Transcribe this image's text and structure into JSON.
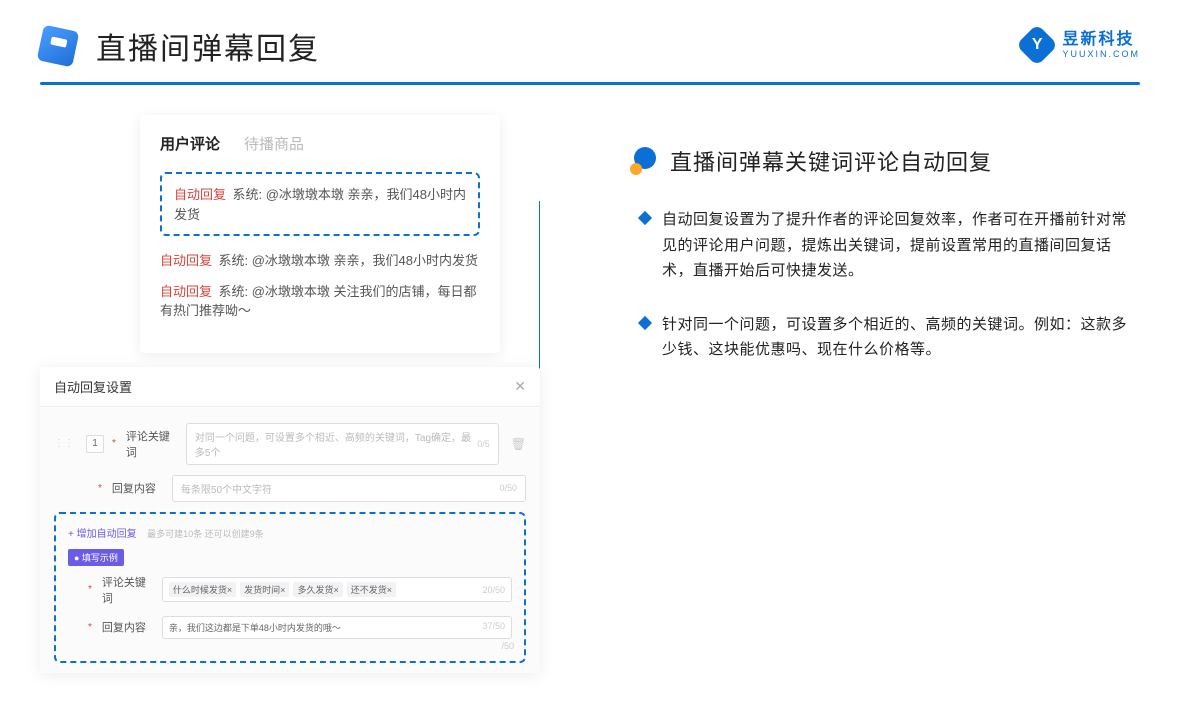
{
  "header": {
    "title": "直播间弹幕回复"
  },
  "brand": {
    "icon_letter": "Y",
    "name": "昱新科技",
    "sub": "YUUXIN.COM"
  },
  "comment_card": {
    "tabs": {
      "active": "用户评论",
      "inactive": "待播商品"
    },
    "highlighted": {
      "tag": "自动回复",
      "prefix": "系统:",
      "text": "@冰墩墩本墩 亲亲，我们48小时内发货"
    },
    "lines": [
      {
        "tag": "自动回复",
        "prefix": "系统:",
        "text": "@冰墩墩本墩 亲亲，我们48小时内发货"
      },
      {
        "tag": "自动回复",
        "prefix": "系统:",
        "text": "@冰墩墩本墩 关注我们的店铺，每日都有热门推荐呦～"
      }
    ]
  },
  "settings": {
    "title": "自动回复设置",
    "row1": {
      "num": "1",
      "label": "评论关键词",
      "placeholder": "对同一个问题，可设置多个相近、高频的关键词，Tag确定，最多5个",
      "counter": "0/5"
    },
    "row2": {
      "label": "回复内容",
      "placeholder": "每条限50个中文字符",
      "counter": "0/50"
    },
    "add_link": "+ 增加自动回复",
    "add_hint": "最多可建10条 还可以创建9条",
    "example_badge": "● 填写示例",
    "ex_label1": "评论关键词",
    "ex_tags": [
      "什么时候发货×",
      "发货时间×",
      "多久发货×",
      "还不发货×"
    ],
    "ex_counter1": "20/50",
    "ex_label2": "回复内容",
    "ex_reply": "亲，我们这边都是下单48小时内发货的哦～",
    "ex_counter2": "37/50",
    "bottom_counter": "/50"
  },
  "right": {
    "section_title": "直播间弹幕关键词评论自动回复",
    "bullets": [
      "自动回复设置为了提升作者的评论回复效率，作者可在开播前针对常见的评论用户问题，提炼出关键词，提前设置常用的直播间回复话术，直播开始后可快捷发送。",
      "针对同一个问题，可设置多个相近的、高频的关键词。例如：这款多少钱、这块能优惠吗、现在什么价格等。"
    ]
  }
}
